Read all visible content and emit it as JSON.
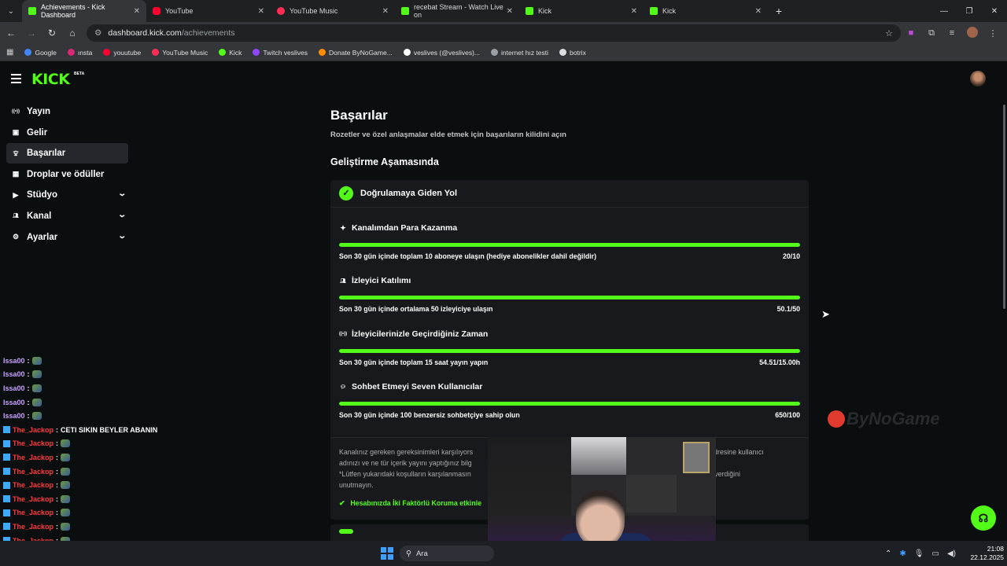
{
  "browser": {
    "tabs": [
      {
        "label": "Achievements - Kick Dashboard",
        "icon": "kick-icon",
        "active": true
      },
      {
        "label": "YouTube",
        "icon": "youtube-icon",
        "active": false
      },
      {
        "label": "YouTube Music",
        "icon": "youtube-music-icon",
        "active": false
      },
      {
        "label": "recebat Stream - Watch Live on",
        "icon": "kick-icon",
        "active": false
      },
      {
        "label": "Kick",
        "icon": "kick-icon",
        "active": false
      },
      {
        "label": "Kick",
        "icon": "kick-icon",
        "active": false
      }
    ],
    "url_host": "dashboard.kick.com",
    "url_path": "/achievements",
    "bookmarks": [
      {
        "label": "Google",
        "color": "#4285f4"
      },
      {
        "label": "ınsta",
        "color": "#d62976"
      },
      {
        "label": "youutube",
        "color": "#ff0033"
      },
      {
        "label": "YouTube Music",
        "color": "#ff2d55"
      },
      {
        "label": "Kick",
        "color": "#53fc18"
      },
      {
        "label": "Twitch veslives",
        "color": "#9146ff"
      },
      {
        "label": "Donate ByNoGame...",
        "color": "#ff8c00"
      },
      {
        "label": "veslives (@veslives)...",
        "color": "#ffffff"
      },
      {
        "label": "internet hız testi",
        "color": "#9aa0a6"
      },
      {
        "label": "botrix",
        "color": "#dddddd"
      }
    ]
  },
  "app": {
    "logo": "KICK",
    "logo_badge": "BETA",
    "accent": "#53fc18"
  },
  "sidebar": {
    "items": [
      {
        "label": "Yayın",
        "icon": "broadcast-icon",
        "expandable": false,
        "active": false
      },
      {
        "label": "Gelir",
        "icon": "wallet-icon",
        "expandable": false,
        "active": false
      },
      {
        "label": "Başarılar",
        "icon": "trophy-icon",
        "expandable": false,
        "active": true
      },
      {
        "label": "Droplar ve ödüller",
        "icon": "gift-icon",
        "expandable": false,
        "active": false
      },
      {
        "label": "Stüdyo",
        "icon": "video-camera-icon",
        "expandable": true,
        "active": false
      },
      {
        "label": "Kanal",
        "icon": "users-icon",
        "expandable": true,
        "active": false
      },
      {
        "label": "Ayarlar",
        "icon": "gear-icon",
        "expandable": true,
        "active": false
      }
    ]
  },
  "main": {
    "title": "Başarılar",
    "subtitle": "Rozetler ve özel anlaşmalar elde etmek için başarıların kilidini açın",
    "section_title": "Geliştirme Aşamasında",
    "card": {
      "title": "Doğrulamaya Giden Yol",
      "goals": [
        {
          "title": "Kanalımdan Para Kazanma",
          "icon": "sparkle-icon",
          "desc": "Son 30 gün içinde toplam 10 aboneye ulaşın (hediye abonelikler dahil değildir)",
          "value": "20/10",
          "progress": 1.0
        },
        {
          "title": "İzleyici Katılımı",
          "icon": "users-icon",
          "desc": "Son 30 gün içinde ortalama 50 izleyiciye ulaşın",
          "value": "50.1/50",
          "progress": 1.0
        },
        {
          "title": "İzleyicilerinizle Geçirdiğiniz Zaman",
          "icon": "broadcast-icon",
          "desc": "Son 30 gün içinde toplam 15 saat yayın yapın",
          "value": "54.51/15.00h",
          "progress": 1.0
        },
        {
          "title": "Sohbet Etmeyi Seven Kullanıcılar",
          "icon": "chat-bubble-icon",
          "desc": "Son 30 gün içinde 100 benzersiz sohbetçiye sahip olun",
          "value": "650/100",
          "progress": 1.0
        }
      ],
      "footer_line1_a": "Kanalınız gereken gereksinimleri karşılıyors",
      "footer_link": "com",
      "footer_line1_b": " adresine kullanıcı",
      "footer_line2": "adınızı ve ne tür içerik yayını yaptığınız bilg",
      "footer_line3_a": "*Lütfen yukarıdaki koşulların karşılanmasın",
      "footer_line3_b": "hakkı verdiğini",
      "footer_line4": "unutmayın.",
      "twofa": "Hesabınızda İki Faktörlü Koruma etkinle"
    }
  },
  "chat": [
    {
      "name": "Issa00",
      "text": "",
      "color": "#c7a0ff",
      "badge": false
    },
    {
      "name": "Issa00",
      "text": "",
      "color": "#c7a0ff",
      "badge": false
    },
    {
      "name": "Issa00",
      "text": "",
      "color": "#c7a0ff",
      "badge": false
    },
    {
      "name": "Issa00",
      "text": "",
      "color": "#c7a0ff",
      "badge": false
    },
    {
      "name": "Issa00",
      "text": "",
      "color": "#c7a0ff",
      "badge": false
    },
    {
      "name": "The_Jackop",
      "text": "CETI SIKIN BEYLER ABANIN",
      "color": "#ff3b3b",
      "badge": true
    },
    {
      "name": "The_Jackop",
      "text": "",
      "color": "#ff3b3b",
      "badge": true
    },
    {
      "name": "The_Jackop",
      "text": "",
      "color": "#ff3b3b",
      "badge": true
    },
    {
      "name": "The_Jackop",
      "text": "",
      "color": "#ff3b3b",
      "badge": true
    },
    {
      "name": "The_Jackop",
      "text": "",
      "color": "#ff3b3b",
      "badge": true
    },
    {
      "name": "The_Jackop",
      "text": "",
      "color": "#ff3b3b",
      "badge": true
    },
    {
      "name": "The_Jackop",
      "text": "",
      "color": "#ff3b3b",
      "badge": true
    },
    {
      "name": "The_Jackop",
      "text": "",
      "color": "#ff3b3b",
      "badge": true
    },
    {
      "name": "The_Jackop",
      "text": "",
      "color": "#ff3b3b",
      "badge": true
    },
    {
      "name": "The_Jackop",
      "text": "",
      "color": "#ff3b3b",
      "badge": true
    }
  ],
  "watermark": "ByNoGame",
  "taskbar": {
    "search_placeholder": "Ara",
    "time": "21:08",
    "date": "22.12.2025"
  }
}
